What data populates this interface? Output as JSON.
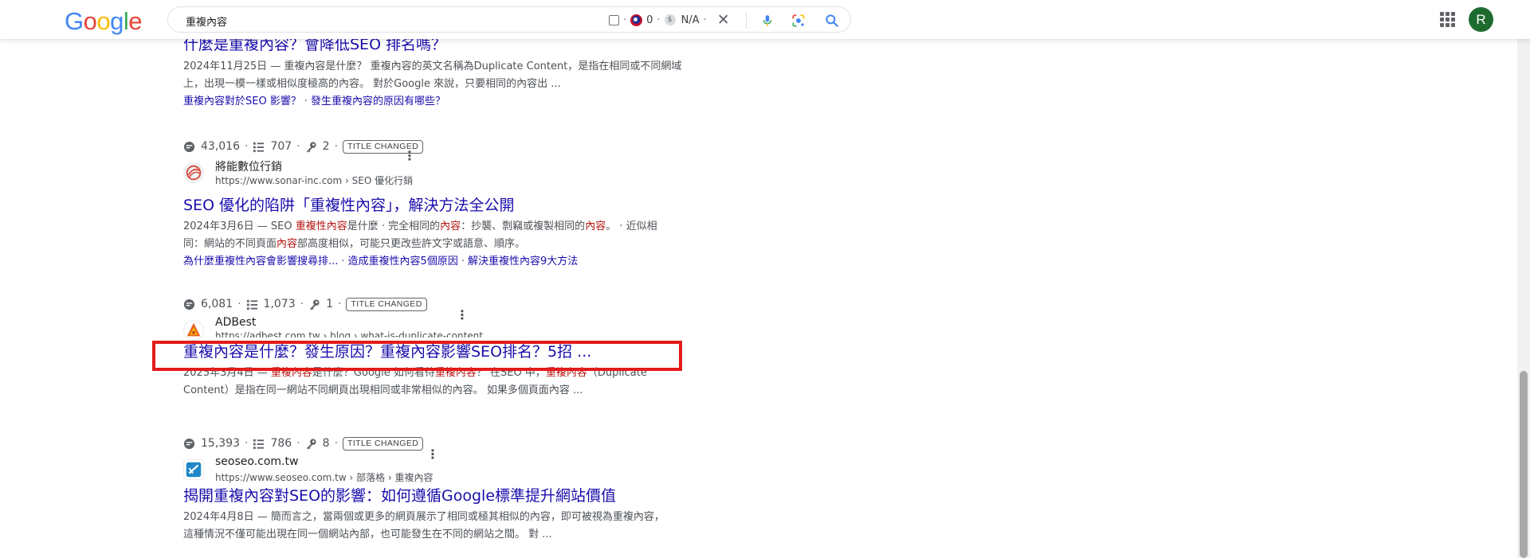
{
  "header": {
    "logo": [
      "G",
      "o",
      "o",
      "g",
      "l",
      "e"
    ],
    "search_query": "重複內容",
    "ext_count": "0",
    "ext_na": "N/A",
    "avatar_initial": "R"
  },
  "results": [
    {
      "title": "什麼是重複內容？會降低SEO 排名嗎？",
      "snippet_line1": "2024年11月25日 — 重複內容是什麼？ 重複內容的英文名稱為Duplicate Content，是指在相同或不同網域",
      "snippet_line2": "上，出現一模一樣或相似度極高的內容。 對於Google 來說，只要相同的內容出 ...",
      "links": [
        "重複內容對於SEO 影響？",
        "發生重複內容的原因有哪些？"
      ]
    },
    {
      "metrics": {
        "a": "43,016",
        "b": "707",
        "c": "2",
        "badge": "TITLE CHANGED"
      },
      "site_name": "將能數位行銷",
      "site_url": "https://www.sonar-inc.com › SEO 優化行銷",
      "title": "SEO 優化的陷阱「重複性內容」，解決方法全公開",
      "snippet_line1": {
        "p1": "2024年3月6日 — SEO ",
        "h1": "重複性內容",
        "p2": "是什麼 · 完全相同的",
        "h2": "內容",
        "p3": "：抄襲、剽竊或複製相同的",
        "h3": "內容",
        "p4": "。 · 近似相"
      },
      "snippet_line2": {
        "p1": "同：網站的不同頁面",
        "h1": "內容",
        "p2": "部高度相似，可能只更改些許文字或語意、順序。"
      },
      "links": [
        "為什麼重複性內容會影響搜尋排...",
        "造成重複性內容5個原因",
        "解決重複性內容9大方法"
      ]
    },
    {
      "metrics": {
        "a": "6,081",
        "b": "1,073",
        "c": "1",
        "badge": "TITLE CHANGED"
      },
      "site_name": "ADBest",
      "site_url": "https://adbest.com.tw › blog › what-is-duplicate-content",
      "title": "重複內容是什麼？發生原因？重複內容影響SEO排名？5招 ...",
      "snippet_line1": {
        "p1": "2025年3月4日 — ",
        "h1": "重複內容",
        "p2": "是什麼？Google 如何看待",
        "h2": "重複內容",
        "p3": "？ 在SEO 中，",
        "h3": "重複內容",
        "p4": "（Duplicate"
      },
      "snippet_line2": "Content）是指在同一網站不同網頁出現相同或非常相似的內容。 如果多個頁面內容 ..."
    },
    {
      "metrics": {
        "a": "15,393",
        "b": "786",
        "c": "8",
        "badge": "TITLE CHANGED"
      },
      "site_name": "seoseo.com.tw",
      "site_url": "https://www.seoseo.com.tw › 部落格 › 重複內容",
      "title": "揭開重複內容對SEO的影響：如何遵循Google標準提升網站價值",
      "snippet_line1": "2024年4月8日 — 簡而言之，當兩個或更多的網頁展示了相同或極其相似的內容，即可被視為重複內容，",
      "snippet_line2": "這種情況不僅可能出現在同一個網站內部，也可能發生在不同的網站之間。 對 ..."
    }
  ],
  "colors": {
    "link": "#1a0dab",
    "highlight_text": "#b31412",
    "annotation_box": "#e31b1b"
  }
}
